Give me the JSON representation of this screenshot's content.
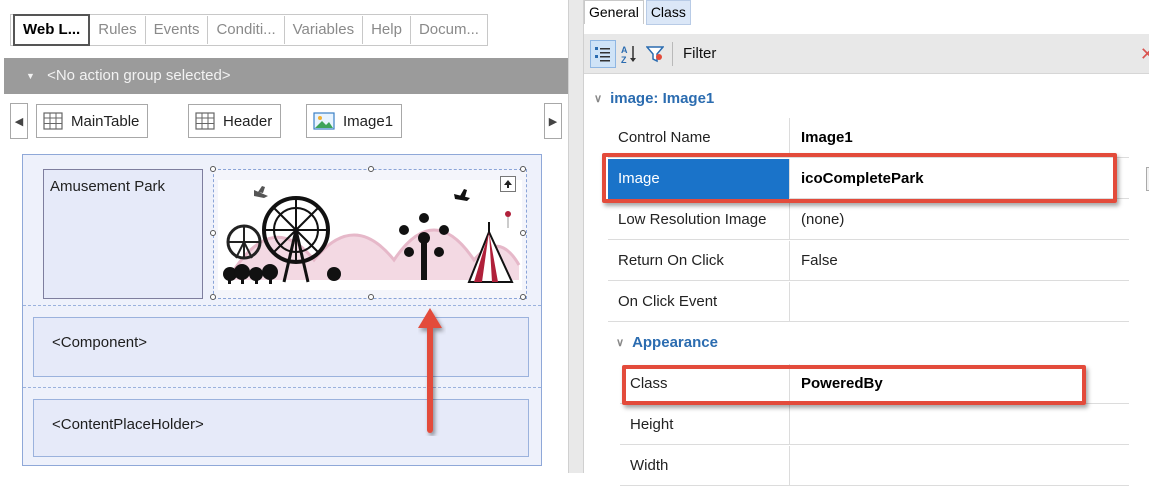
{
  "designer": {
    "tabs": [
      "Web L...",
      "Rules",
      "Events",
      "Conditi...",
      "Variables",
      "Help",
      "Docum..."
    ],
    "action_group": "<No action group selected>",
    "breadcrumbs": [
      "MainTable",
      "Header",
      "Image1"
    ],
    "canvas": {
      "title_text": "Amusement Park",
      "component_text": "<Component>",
      "placeholder_text": "<ContentPlaceHolder>"
    }
  },
  "properties": {
    "tabs": [
      "General",
      "Class"
    ],
    "filter_label": "Filter",
    "category_main": "image: Image1",
    "category_appearance": "Appearance",
    "rows": [
      {
        "name": "Control Name",
        "value": "Image1"
      },
      {
        "name": "Image",
        "value": "icoCompletePark"
      },
      {
        "name": "Low Resolution Image",
        "value": "(none)"
      },
      {
        "name": "Return On Click",
        "value": "False"
      },
      {
        "name": "On Click Event",
        "value": ""
      }
    ],
    "appearance_rows": [
      {
        "name": "Class",
        "value": "PoweredBy"
      },
      {
        "name": "Height",
        "value": ""
      },
      {
        "name": "Width",
        "value": ""
      }
    ],
    "ellipsis": "..."
  },
  "colors": {
    "highlight": "#e34b3b",
    "selection": "#1a73c9",
    "category": "#2b6cb0"
  }
}
